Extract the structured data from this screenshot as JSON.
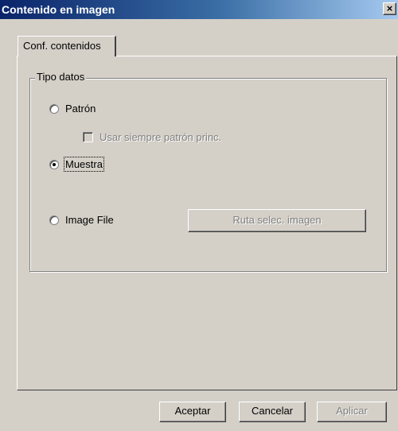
{
  "window": {
    "title": "Contenido en imagen",
    "close_symbol": "×"
  },
  "tabs": [
    {
      "label": "Conf. contenidos"
    }
  ],
  "group": {
    "label": "Tipo datos",
    "options": [
      {
        "label": "Patrón",
        "checked": false
      },
      {
        "label": "Muestra",
        "checked": true
      },
      {
        "label": "Image File",
        "checked": false
      }
    ],
    "checkbox": {
      "label": "Usar siempre patrón princ.",
      "enabled": false,
      "checked": false
    },
    "path_button": {
      "label": "Ruta selec. imagen",
      "enabled": false
    }
  },
  "footer": {
    "ok_label": "Aceptar",
    "cancel_label": "Cancelar",
    "apply_label": "Aplicar"
  }
}
